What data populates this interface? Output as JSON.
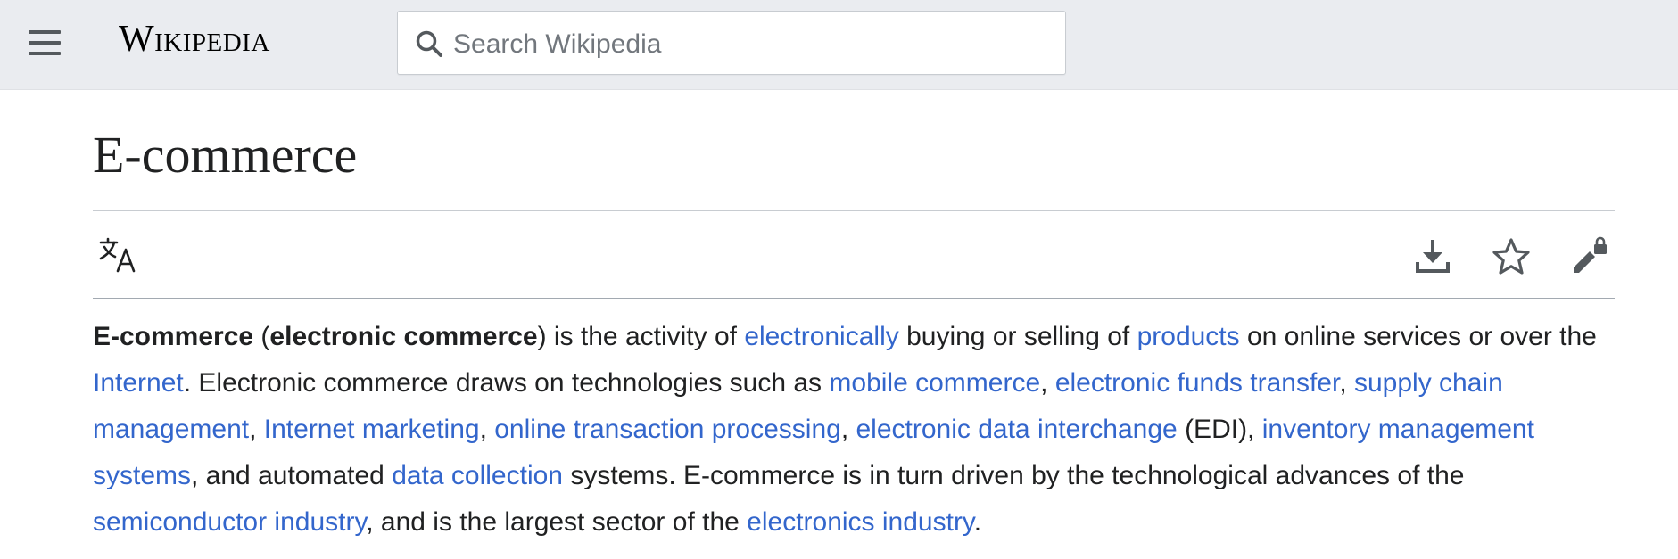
{
  "header": {
    "logo_text": "Wikipedia",
    "search_placeholder": "Search Wikipedia"
  },
  "page": {
    "title": "E-commerce"
  },
  "toolbar": {
    "icons": [
      "language-icon",
      "download-icon",
      "star-icon",
      "edit-locked-icon"
    ]
  },
  "lead": {
    "s01": "E-commerce",
    "s02": " (",
    "s03": "electronic commerce",
    "s04": ") is the activity of ",
    "s05": "electronically",
    "s06": " buying or selling of ",
    "s07": "products",
    "s08": " on online services or over the ",
    "s09": "Internet",
    "s10": ". Electronic commerce draws on technologies such as ",
    "s11": "mobile commerce",
    "s12": ", ",
    "s13": "electronic funds transfer",
    "s14": ", ",
    "s15": "supply chain management",
    "s16": ", ",
    "s17": "Internet marketing",
    "s18": ", ",
    "s19": "online transaction processing",
    "s20": ", ",
    "s21": "electronic data interchange",
    "s22": " (EDI), ",
    "s23": "inventory management systems",
    "s24": ", and automated ",
    "s25": "data collection",
    "s26": " systems. E-commerce is in turn driven by the technological advances of the ",
    "s27": "semiconductor industry",
    "s28": ", and is the largest sector of the ",
    "s29": "electronics industry",
    "s30": "."
  },
  "colors": {
    "link": "#3366cc",
    "header_bg": "#eaecf0",
    "text": "#202122"
  }
}
